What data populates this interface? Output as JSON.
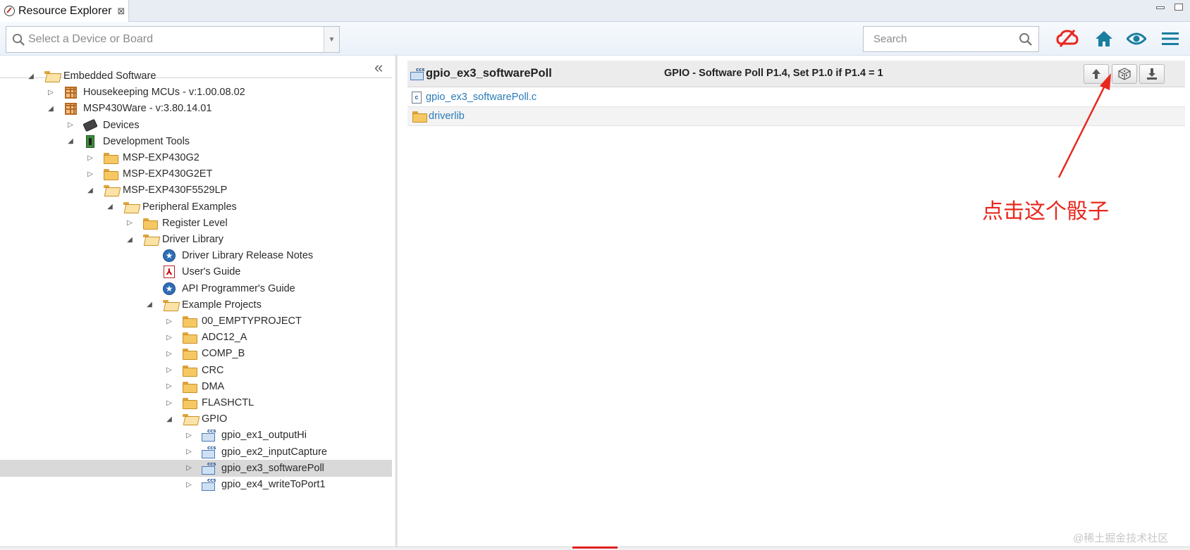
{
  "tab": {
    "title": "Resource Explorer",
    "close_glyph": "⊠"
  },
  "toolbar": {
    "device_placeholder": "Select a Device or Board",
    "search_placeholder": "Search",
    "icons": [
      "cloud-offline-icon",
      "home-icon",
      "eye-icon",
      "menu-icon"
    ],
    "cloud_color": "#e8281e",
    "accent_color": "#1a7ea0"
  },
  "tree": {
    "collapse_glyph": "«",
    "rows": [
      {
        "label": "Embedded Software",
        "depth": 0,
        "expanded": true,
        "icon": "folder-open"
      },
      {
        "label": "Housekeeping MCUs - v:1.00.08.02",
        "depth": 1,
        "expanded": false,
        "icon": "package"
      },
      {
        "label": "MSP430Ware - v:3.80.14.01",
        "depth": 1,
        "expanded": true,
        "icon": "package"
      },
      {
        "label": "Devices",
        "depth": 2,
        "expanded": false,
        "icon": "chip"
      },
      {
        "label": "Development Tools",
        "depth": 2,
        "expanded": true,
        "icon": "board"
      },
      {
        "label": "MSP-EXP430G2",
        "depth": 3,
        "expanded": false,
        "icon": "folder"
      },
      {
        "label": "MSP-EXP430G2ET",
        "depth": 3,
        "expanded": false,
        "icon": "folder"
      },
      {
        "label": "MSP-EXP430F5529LP",
        "depth": 3,
        "expanded": true,
        "icon": "folder-open"
      },
      {
        "label": "Peripheral Examples",
        "depth": 4,
        "expanded": true,
        "icon": "folder-open"
      },
      {
        "label": "Register Level",
        "depth": 5,
        "expanded": false,
        "icon": "folder"
      },
      {
        "label": "Driver Library",
        "depth": 5,
        "expanded": true,
        "icon": "folder-open"
      },
      {
        "label": "Driver Library Release Notes",
        "depth": 6,
        "leaf": true,
        "icon": "star"
      },
      {
        "label": "User's Guide",
        "depth": 6,
        "leaf": true,
        "icon": "pdf"
      },
      {
        "label": "API Programmer's Guide",
        "depth": 6,
        "leaf": true,
        "icon": "star"
      },
      {
        "label": "Example Projects",
        "depth": 6,
        "expanded": true,
        "icon": "folder-open"
      },
      {
        "label": "00_EMPTYPROJECT",
        "depth": 7,
        "expanded": false,
        "icon": "folder"
      },
      {
        "label": "ADC12_A",
        "depth": 7,
        "expanded": false,
        "icon": "folder"
      },
      {
        "label": "COMP_B",
        "depth": 7,
        "expanded": false,
        "icon": "folder"
      },
      {
        "label": "CRC",
        "depth": 7,
        "expanded": false,
        "icon": "folder"
      },
      {
        "label": "DMA",
        "depth": 7,
        "expanded": false,
        "icon": "folder"
      },
      {
        "label": "FLASHCTL",
        "depth": 7,
        "expanded": false,
        "icon": "folder"
      },
      {
        "label": "GPIO",
        "depth": 7,
        "expanded": true,
        "icon": "folder-open"
      },
      {
        "label": "gpio_ex1_outputHi",
        "depth": 8,
        "expanded": false,
        "icon": "ccs"
      },
      {
        "label": "gpio_ex2_inputCapture",
        "depth": 8,
        "expanded": false,
        "icon": "ccs"
      },
      {
        "label": "gpio_ex3_softwarePoll",
        "depth": 8,
        "expanded": false,
        "icon": "ccs",
        "selected": true
      },
      {
        "label": "gpio_ex4_writeToPort1",
        "depth": 8,
        "expanded": false,
        "icon": "ccs"
      }
    ]
  },
  "detail": {
    "title": "gpio_ex3_softwarePoll",
    "description": "GPIO - Software Poll P1.4, Set P1.0 if P1.4 = 1",
    "icon_text": "ccs",
    "files": [
      {
        "name": "gpio_ex3_softwarePoll.c",
        "type": "c-file"
      },
      {
        "name": "driverlib",
        "type": "folder"
      }
    ],
    "actions": [
      "up-arrow-icon",
      "import-project-icon",
      "download-icon"
    ]
  },
  "annotation": {
    "text": "点击这个骰子",
    "color": "#e8281e"
  },
  "watermark": "@稀土掘金技术社区"
}
